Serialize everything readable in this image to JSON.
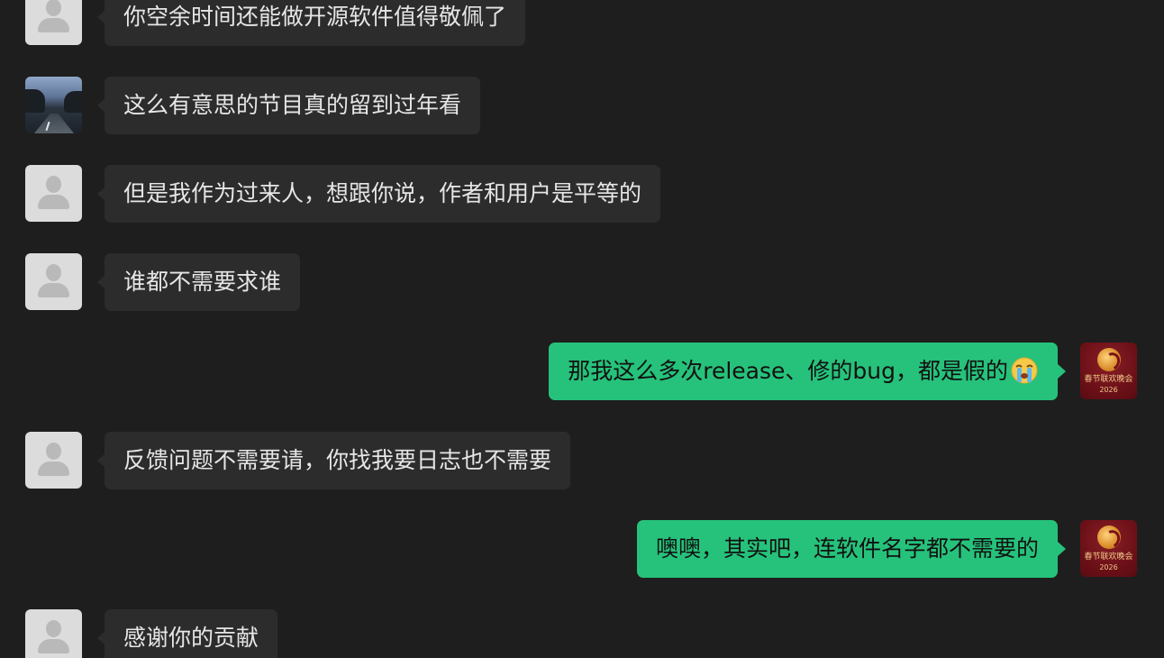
{
  "conversation": {
    "messages": [
      {
        "side": "left",
        "avatar": "default",
        "text": "你空余时间还能做开源软件值得敬佩了"
      },
      {
        "side": "left",
        "avatar": "photo",
        "text": "这么有意思的节目真的留到过年看"
      },
      {
        "side": "left",
        "avatar": "default",
        "text": "但是我作为过来人，想跟你说，作者和用户是平等的"
      },
      {
        "side": "left",
        "avatar": "default",
        "text": "谁都不需要求谁"
      },
      {
        "side": "right",
        "avatar": "gala",
        "text": "那我这么多次release、修的bug，都是假的",
        "emoji": "crying-face-emoji"
      },
      {
        "side": "left",
        "avatar": "default",
        "text": "反馈问题不需要请，你找我要日志也不需要"
      },
      {
        "side": "right",
        "avatar": "gala",
        "text": "噢噢，其实吧，连软件名字都不需要的"
      },
      {
        "side": "left",
        "avatar": "default",
        "text": "感谢你的贡献"
      }
    ]
  },
  "gala_avatar": {
    "line1": "春节联欢晚会",
    "line2": "2026"
  },
  "colors": {
    "background": "#1e1e1e",
    "incoming_bubble": "#2c2c2c",
    "outgoing_bubble": "#26c27b"
  }
}
